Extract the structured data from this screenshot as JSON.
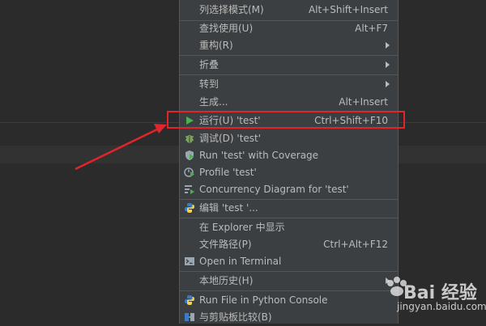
{
  "colors": {
    "menu_bg": "#3c3f41",
    "text": "#bbbbbb",
    "highlight": "#e3242b",
    "run_green": "#4caf50",
    "debug_green": "#7ea659",
    "python_blue": "#3b7bbf",
    "python_yellow": "#f3d14e"
  },
  "menu": {
    "items": [
      {
        "label": "列选择模式(M)",
        "shortcut": "Alt+Shift+Insert"
      },
      {
        "label": "查找使用(U)",
        "shortcut": "Alt+F7"
      },
      {
        "label": "重构(R)",
        "submenu": true
      },
      {
        "label": "折叠",
        "submenu": true
      },
      {
        "label": "转到",
        "submenu": true
      },
      {
        "label": "生成...",
        "shortcut": "Alt+Insert"
      },
      {
        "label": "运行(U) 'test'",
        "shortcut": "Ctrl+Shift+F10",
        "icon": "run-icon"
      },
      {
        "label": "调试(D) 'test'",
        "icon": "debug-icon"
      },
      {
        "label": "Run 'test' with Coverage",
        "icon": "coverage-icon"
      },
      {
        "label": "Profile 'test'",
        "icon": "profile-icon"
      },
      {
        "label": "Concurrency Diagram for 'test'",
        "icon": "concurrency-icon"
      },
      {
        "label": "编辑 'test '...",
        "icon": "python-icon"
      },
      {
        "label": "在 Explorer 中显示"
      },
      {
        "label": "文件路径(P)",
        "shortcut": "Ctrl+Alt+F12"
      },
      {
        "label": "Open in Terminal",
        "icon": "terminal-icon"
      },
      {
        "label": "本地历史(H)",
        "submenu": true
      },
      {
        "label": "Run File in Python Console",
        "icon": "python-console-icon"
      },
      {
        "label": "与剪贴板比较(B)",
        "icon": "compare-icon"
      }
    ]
  },
  "watermark": {
    "brand": "Bai 经验",
    "url": "jingyan.baidu.com"
  }
}
